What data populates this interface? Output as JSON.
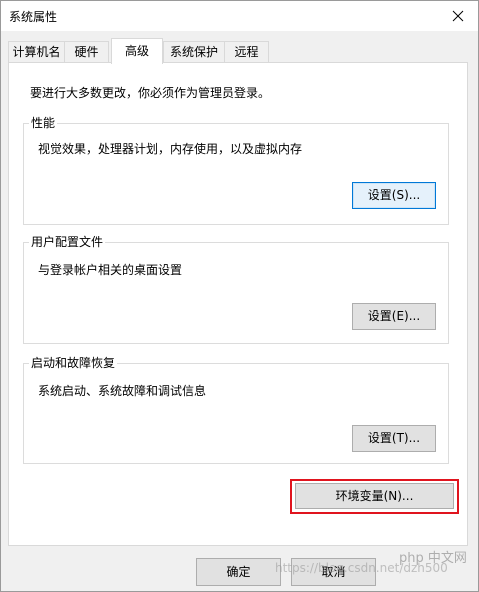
{
  "window": {
    "title": "系统属性"
  },
  "tabs": [
    {
      "label": "计算机名",
      "active": false
    },
    {
      "label": "硬件",
      "active": false
    },
    {
      "label": "高级",
      "active": true
    },
    {
      "label": "系统保护",
      "active": false
    },
    {
      "label": "远程",
      "active": false
    }
  ],
  "intro": "要进行大多数更改，你必须作为管理员登录。",
  "groups": {
    "performance": {
      "title": "性能",
      "desc": "视觉效果，处理器计划，内存使用，以及虚拟内存",
      "button": "设置(S)..."
    },
    "user_profiles": {
      "title": "用户配置文件",
      "desc": "与登录帐户相关的桌面设置",
      "button": "设置(E)..."
    },
    "startup_recovery": {
      "title": "启动和故障恢复",
      "desc": "系统启动、系统故障和调试信息",
      "button": "设置(T)..."
    }
  },
  "env_button": "环境变量(N)...",
  "footer": {
    "ok": "确定",
    "cancel": "取消"
  },
  "watermark": {
    "text": "https://blog.csdn.net/dzh500",
    "logo": "php 中文网"
  },
  "colors": {
    "highlight": "#e0141e",
    "focus_border": "#0078d7"
  }
}
